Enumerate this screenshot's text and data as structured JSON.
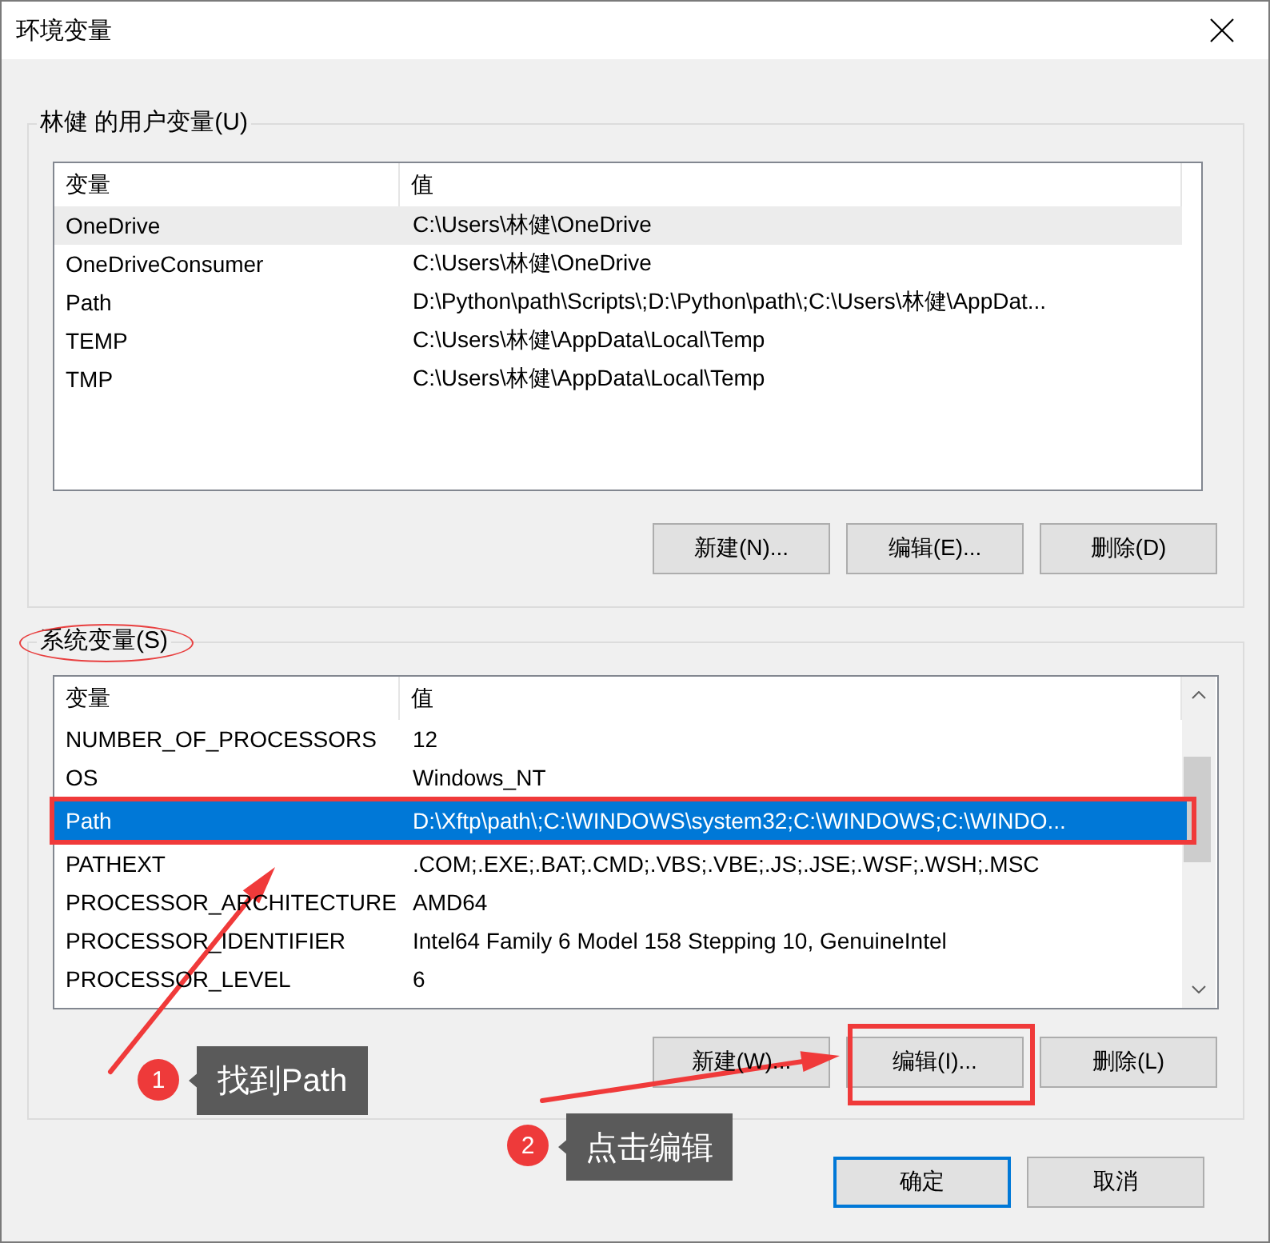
{
  "window": {
    "title": "环境变量"
  },
  "user_variables": {
    "title": "林健 的用户变量(U)",
    "circled": false,
    "focused": false,
    "has_scrollbar": false,
    "columns": [
      "变量",
      "值"
    ],
    "rows": [
      {
        "name": "OneDrive",
        "value": "C:\\Users\\林健\\OneDrive",
        "selected": true
      },
      {
        "name": "OneDriveConsumer",
        "value": "C:\\Users\\林健\\OneDrive",
        "selected": false
      },
      {
        "name": "Path",
        "value": "D:\\Python\\path\\Scripts\\;D:\\Python\\path\\;C:\\Users\\林健\\AppDat...",
        "selected": false
      },
      {
        "name": "TEMP",
        "value": "C:\\Users\\林健\\AppData\\Local\\Temp",
        "selected": false
      },
      {
        "name": "TMP",
        "value": "C:\\Users\\林健\\AppData\\Local\\Temp",
        "selected": false
      }
    ],
    "buttons": [
      {
        "label": "新建(N)..."
      },
      {
        "label": "编辑(E)..."
      },
      {
        "label": "删除(D)"
      }
    ]
  },
  "system_variables": {
    "title": "系统变量(S)",
    "circled": true,
    "focused": true,
    "has_scrollbar": true,
    "columns": [
      "变量",
      "值"
    ],
    "rows": [
      {
        "name": "NUMBER_OF_PROCESSORS",
        "value": "12",
        "selected": false,
        "highlighted": false
      },
      {
        "name": "OS",
        "value": "Windows_NT",
        "selected": false,
        "highlighted": false
      },
      {
        "name": "Path",
        "value": "D:\\Xftp\\path\\;C:\\WINDOWS\\system32;C:\\WINDOWS;C:\\WINDO...",
        "selected": true,
        "highlighted": true
      },
      {
        "name": "PATHEXT",
        "value": ".COM;.EXE;.BAT;.CMD;.VBS;.VBE;.JS;.JSE;.WSF;.WSH;.MSC",
        "selected": false,
        "highlighted": false
      },
      {
        "name": "PROCESSOR_ARCHITECTURE",
        "value": "AMD64",
        "selected": false,
        "highlighted": false
      },
      {
        "name": "PROCESSOR_IDENTIFIER",
        "value": "Intel64 Family 6 Model 158 Stepping 10, GenuineIntel",
        "selected": false,
        "highlighted": false
      },
      {
        "name": "PROCESSOR_LEVEL",
        "value": "6",
        "selected": false,
        "highlighted": false
      }
    ],
    "buttons": [
      {
        "label": "新建(W)...",
        "highlighted": false
      },
      {
        "label": "编辑(I)...",
        "highlighted": true
      },
      {
        "label": "删除(L)",
        "highlighted": false
      }
    ]
  },
  "footer_buttons": [
    {
      "label": "确定",
      "default": true
    },
    {
      "label": "取消",
      "default": false
    }
  ],
  "callouts": [
    {
      "number": "1",
      "text": "找到Path"
    },
    {
      "number": "2",
      "text": "点击编辑"
    }
  ]
}
